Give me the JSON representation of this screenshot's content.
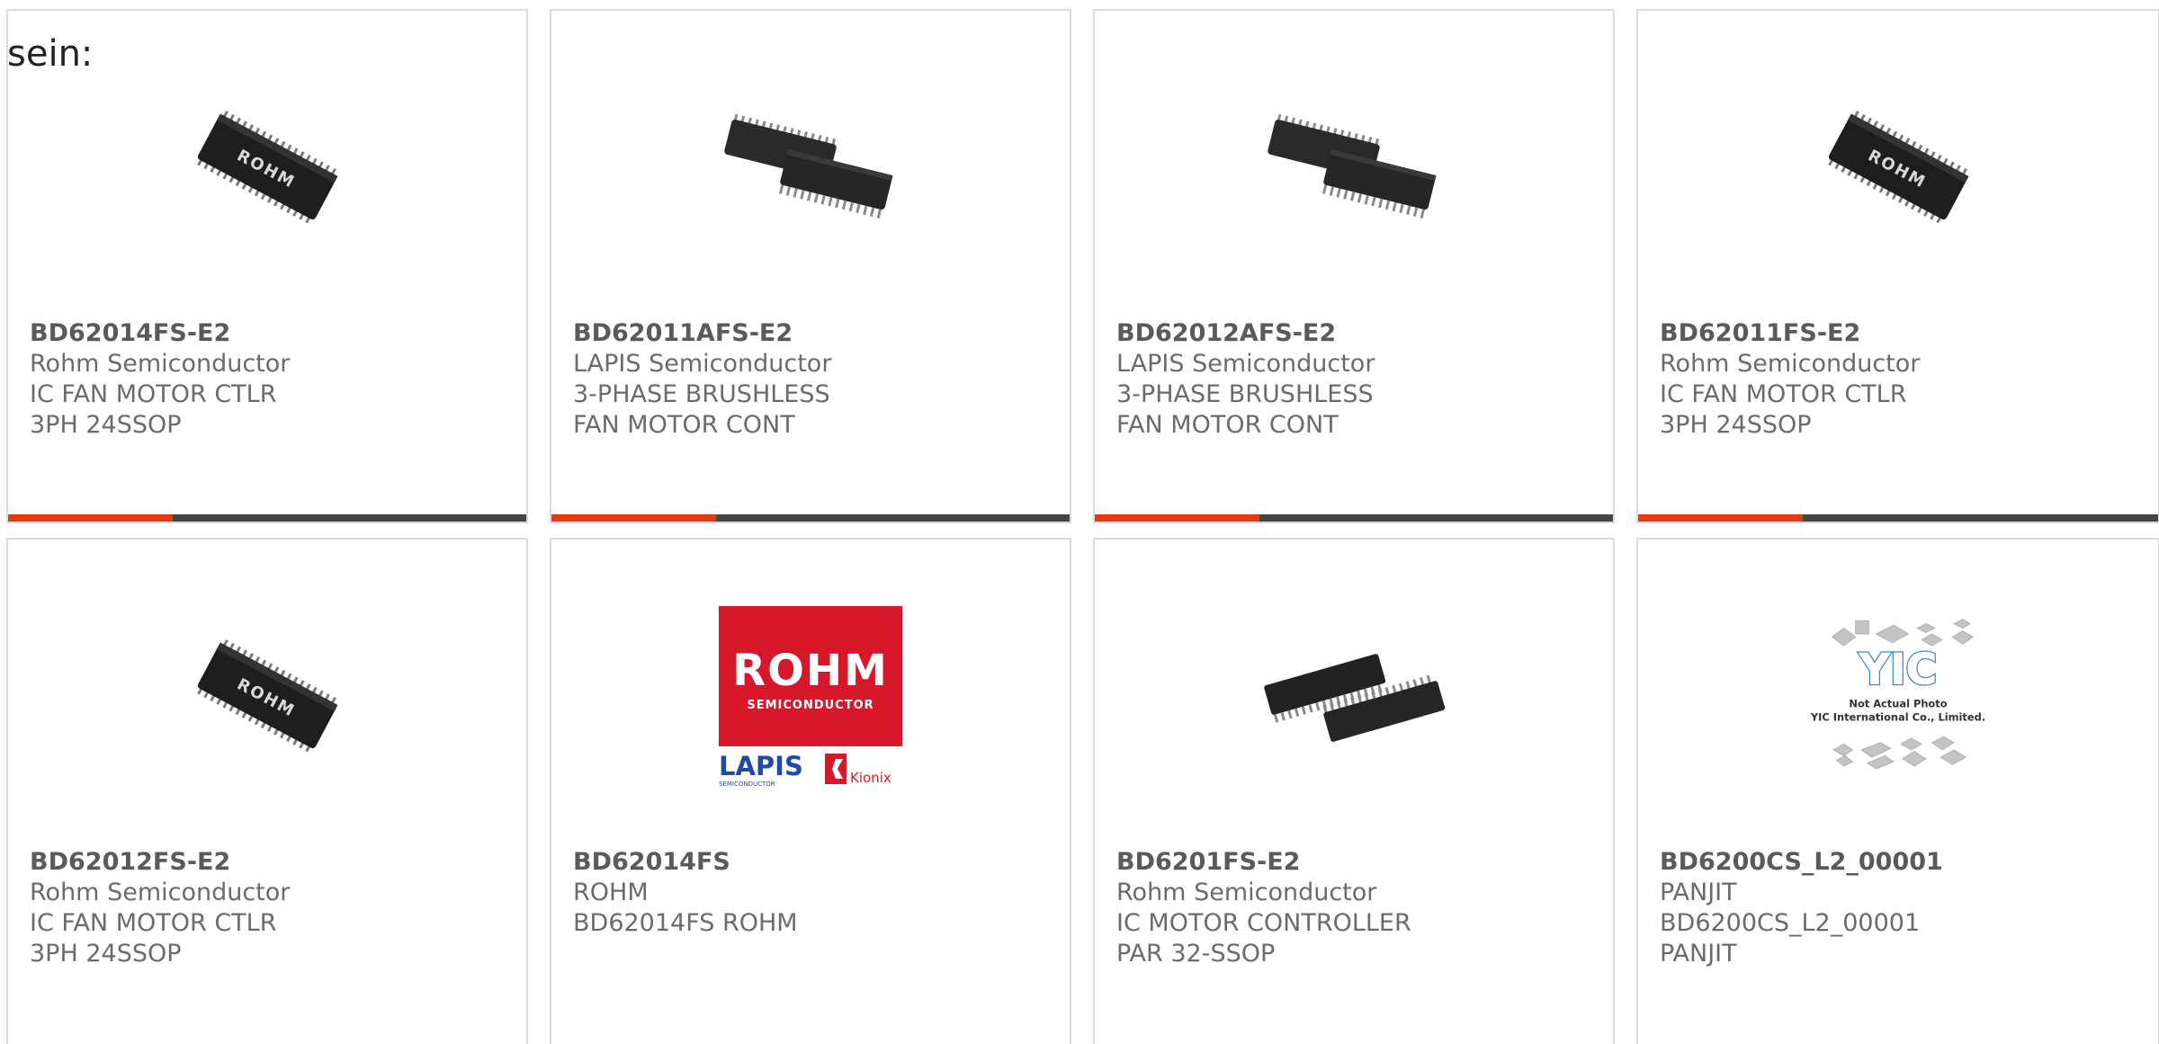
{
  "intro": {
    "text": "sein:"
  },
  "colors": {
    "accent": "#e8380d",
    "bar_dark": "#454545",
    "rohm_red": "#d7182a",
    "lapis_blue": "#1f4aa8"
  },
  "products": [
    {
      "part_number": "BD62014FS-E2",
      "manufacturer": "Rohm Semiconductor",
      "description": "IC FAN MOTOR CTLR 3PH 24SSOP",
      "image": "chip-rohm-icon"
    },
    {
      "part_number": "BD62011AFS-E2",
      "manufacturer": "LAPIS Semiconductor",
      "description": "3-PHASE BRUSHLESS FAN MOTOR CONT",
      "image": "chip-pair-icon"
    },
    {
      "part_number": "BD62012AFS-E2",
      "manufacturer": "LAPIS Semiconductor",
      "description": "3-PHASE BRUSHLESS FAN MOTOR CONT",
      "image": "chip-pair-icon"
    },
    {
      "part_number": "BD62011FS-E2",
      "manufacturer": "Rohm Semiconductor",
      "description": "IC FAN MOTOR CTLR 3PH 24SSOP",
      "image": "chip-rohm-icon"
    },
    {
      "part_number": "BD62012FS-E2",
      "manufacturer": "Rohm Semiconductor",
      "description": "IC FAN MOTOR CTLR 3PH 24SSOP",
      "image": "chip-rohm-icon"
    },
    {
      "part_number": "BD62014FS",
      "manufacturer": "ROHM",
      "description": "BD62014FS ROHM",
      "image": "rohm-logo-icon",
      "logo": {
        "brand": "ROHM",
        "sub": "SEMICONDUCTOR",
        "lapis": "LAPIS",
        "lapis_sub": "SEMICONDUCTOR",
        "kionix": "Kionix"
      }
    },
    {
      "part_number": "BD6201FS-E2",
      "manufacturer": "Rohm Semiconductor",
      "description": "IC MOTOR CONTROLLER PAR 32-SSOP",
      "image": "chip-pair-long-icon"
    },
    {
      "part_number": "BD6200CS_L2_00001",
      "manufacturer": "PANJIT",
      "description": "BD6200CS_L2_00001 PANJIT",
      "image": "yic-placeholder-icon",
      "placeholder": {
        "line1": "Not Actual Photo",
        "line2": "YIC International Co., Limited."
      }
    }
  ]
}
